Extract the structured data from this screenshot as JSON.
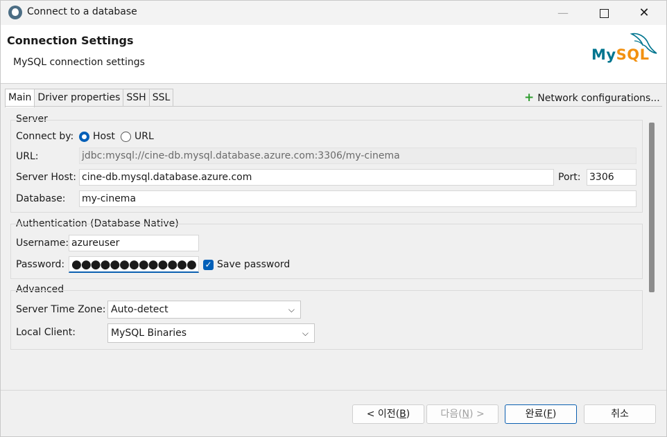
{
  "window": {
    "title": "Connect to a database",
    "minimize_glyph": "—",
    "close_glyph": "✕"
  },
  "header": {
    "title": "Connection Settings",
    "subtitle": "MySQL connection settings",
    "logo": {
      "part1": "My",
      "part2": "SQL",
      "colors": {
        "my": "#00758f",
        "sql": "#f29111"
      }
    }
  },
  "tabs": [
    {
      "label": "Main",
      "active": true
    },
    {
      "label": "Driver properties",
      "active": false
    },
    {
      "label": "SSH",
      "active": false
    },
    {
      "label": "SSL",
      "active": false
    }
  ],
  "network_config": {
    "icon": "+",
    "label": "Network configurations..."
  },
  "server": {
    "group_title": "Server",
    "connect_by_label": "Connect by:",
    "option_host": "Host",
    "option_url": "URL",
    "selected": "Host",
    "url_label": "URL:",
    "url_value": "jdbc:mysql://cine-db.mysql.database.azure.com:3306/my-cinema",
    "host_label": "Server Host:",
    "host_value": "cine-db.mysql.database.azure.com",
    "port_label": "Port:",
    "port_value": "3306",
    "database_label": "Database:",
    "database_value": "my-cinema"
  },
  "auth": {
    "group_title": "Authentication (Database Native)",
    "username_label": "Username:",
    "username_value": "azureuser",
    "password_label": "Password:",
    "password_mask": "●●●●●●●●●●●●●",
    "save_password_label": "Save password",
    "save_password_checked": true,
    "check_glyph": "✓"
  },
  "advanced": {
    "group_title": "Advanced",
    "timezone_label": "Server Time Zone:",
    "timezone_value": "Auto-detect",
    "client_label": "Local Client:",
    "client_value": "MySQL Binaries",
    "chevron": "⌵"
  },
  "footer": {
    "back": {
      "prefix": "< 이전(",
      "key": "B",
      "suffix": ")"
    },
    "next": {
      "prefix": "다음(",
      "key": "N",
      "suffix": ") >"
    },
    "finish": {
      "prefix": "완료(",
      "key": "F",
      "suffix": ")"
    },
    "cancel": "취소"
  },
  "accent_color": "#005fb8"
}
